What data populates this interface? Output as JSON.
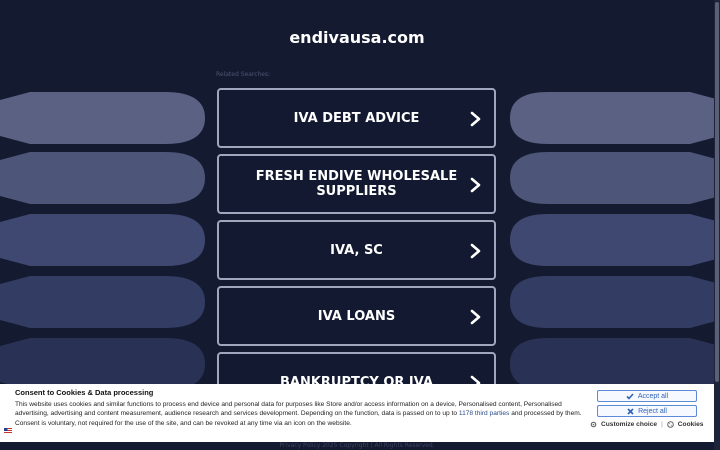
{
  "site": {
    "title": "endivausa.com"
  },
  "related": {
    "label": "Related Searches:",
    "items": [
      {
        "label": "IVA DEBT ADVICE"
      },
      {
        "label": "FRESH ENDIVE WHOLESALE SUPPLIERS"
      },
      {
        "label": "IVA, SC"
      },
      {
        "label": "IVA LOANS"
      },
      {
        "label": "BANKRUPTCY OR IVA"
      }
    ]
  },
  "footer": {
    "text": "Privacy Policy   2025 Copyright | All Rights Reserved."
  },
  "consent": {
    "title": "Consent to Cookies & Data processing",
    "body_pre": "This website uses cookies and similar functions to process end device and personal data for purposes like Store and/or access information on a device, Personalised content, Personalised advertising, advertising and content measurement, audience research and services development. Depending on the function, data is passed on to up to ",
    "link_text": "1178 third parties",
    "body_post": " and processed by them. Consent is voluntary, not required for the use of the site, and can be revoked at any time via an icon on the website.",
    "accept_all": "Accept all",
    "reject_all": "Reject all",
    "customize": "Customize choice",
    "separator": "|",
    "cookies": "Cookies"
  },
  "colors": {
    "background": "#141a30",
    "button_border": "#a0a6bc",
    "consent_accent": "#2f63b7"
  }
}
